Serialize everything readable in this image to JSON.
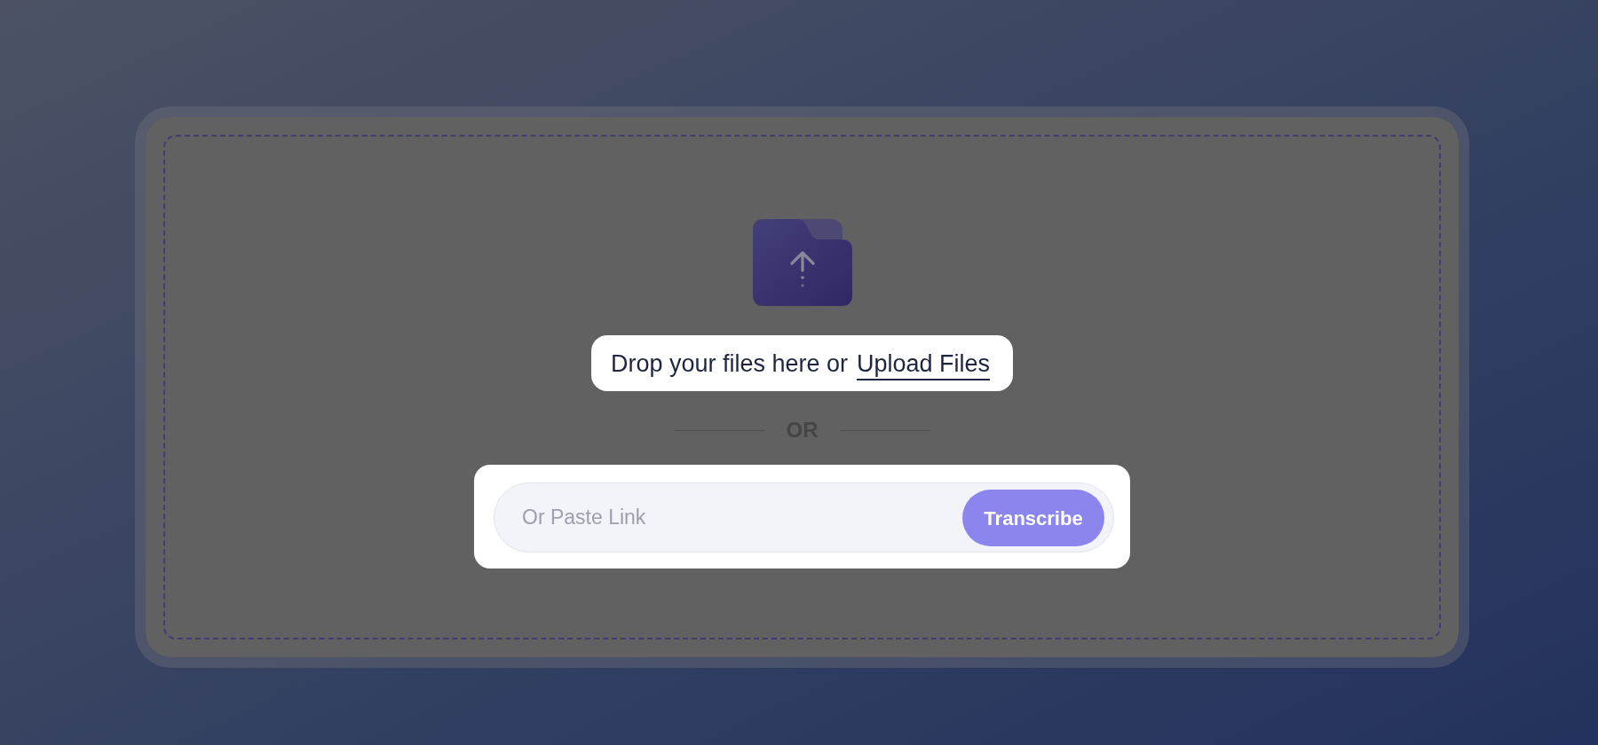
{
  "upload": {
    "prompt": "Drop your files here or",
    "link": "Upload Files"
  },
  "divider": {
    "label": "OR"
  },
  "link_form": {
    "placeholder": "Or Paste Link",
    "button": "Transcribe"
  }
}
